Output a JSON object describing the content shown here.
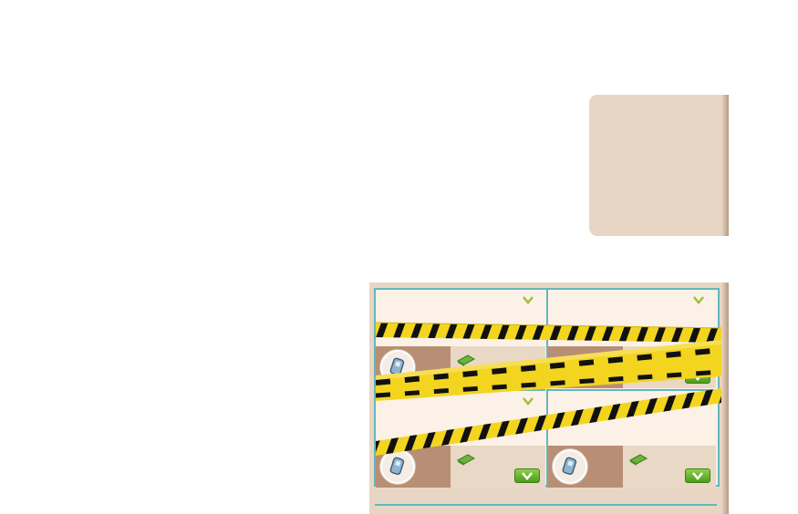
{
  "colors": {
    "panel_bg": "#e8d6c4",
    "cell_bg": "#fcf1e6",
    "cell_bottom_bg": "#e9d8c6",
    "cell_avatar_strip": "#b88e74",
    "grid_border": "#64b7bd",
    "button_green": "#5fae24",
    "tape_yellow": "#f3d51f",
    "tape_black": "#111111"
  },
  "board": {
    "cells": [
      {
        "id": "top-left",
        "status": "locked",
        "has_chevron": true,
        "has_cash_icon": true,
        "has_phone_avatar": true,
        "has_go_button": false
      },
      {
        "id": "top-right",
        "status": "locked",
        "has_chevron": true,
        "has_cash_icon": false,
        "has_phone_avatar": false,
        "has_go_button": true
      },
      {
        "id": "bottom-left",
        "status": "locked",
        "has_chevron": true,
        "has_cash_icon": true,
        "has_phone_avatar": true,
        "has_go_button": true
      },
      {
        "id": "bottom-right",
        "status": "locked",
        "has_chevron": false,
        "has_cash_icon": true,
        "has_phone_avatar": true,
        "has_go_button": true
      }
    ],
    "overlay": "caution-tape"
  },
  "icons": {
    "chevron": "chevron-down-icon",
    "cash": "cash-icon",
    "phone": "phone-icon",
    "go": "chevron-down-button-icon"
  }
}
